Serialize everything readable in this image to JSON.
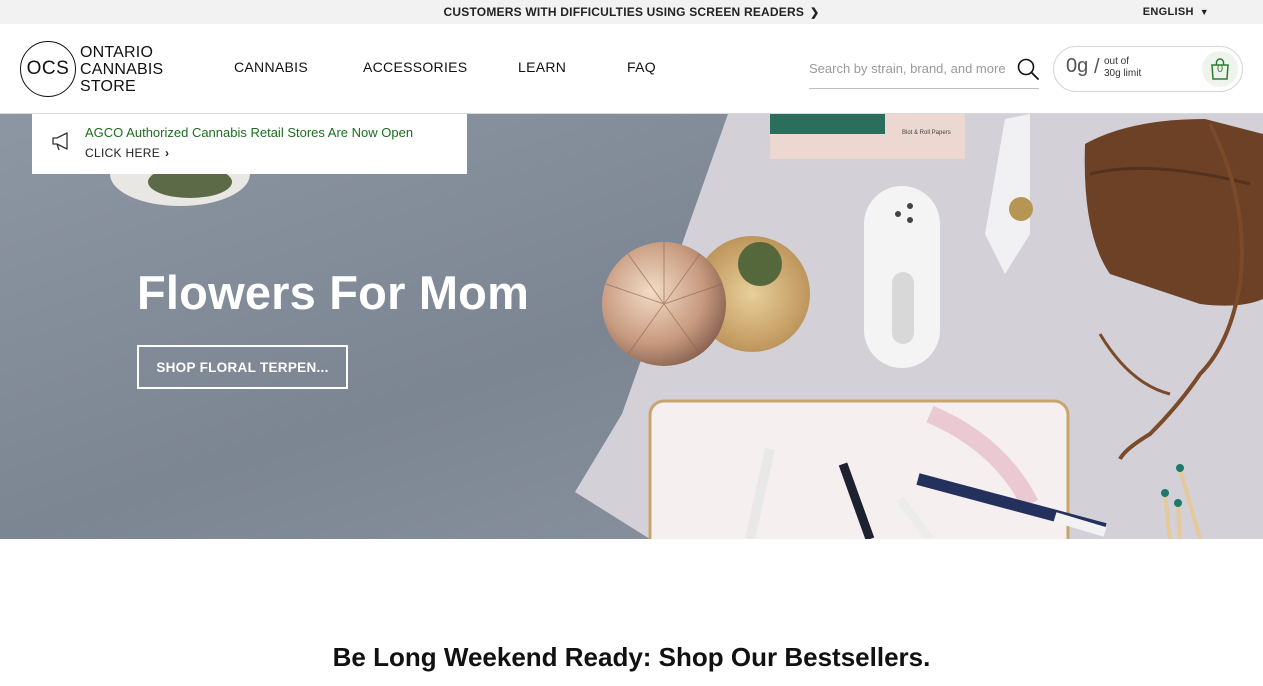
{
  "topbar": {
    "screen_reader_text": "CUSTOMERS WITH DIFFICULTIES USING SCREEN READERS",
    "language": "ENGLISH"
  },
  "logo": {
    "mark": "OCS",
    "line1": "ONTARIO",
    "line2": "CANNABIS",
    "line3": "STORE"
  },
  "nav": {
    "items": [
      {
        "label": "CANNABIS"
      },
      {
        "label": "ACCESSORIES"
      },
      {
        "label": "LEARN"
      },
      {
        "label": "FAQ"
      }
    ]
  },
  "search": {
    "placeholder": "Search by strain, brand, and more",
    "icon": "search-icon"
  },
  "limit": {
    "amount": "0g",
    "separator": "/",
    "out_of": "out of",
    "limit_text": "30g limit",
    "cart_count": "0",
    "cart_icon": "shopping-bag-icon",
    "accent": "#2e7d32"
  },
  "notice": {
    "icon": "megaphone-icon",
    "message": "AGCO Authorized Cannabis Retail Stores Are Now Open",
    "cta": "CLICK HERE",
    "color": "#1b6e1f"
  },
  "hero": {
    "title": "Flowers For Mom",
    "button": "SHOP FLORAL TERPEN...",
    "booklet_label": "Blot & Roll Papers"
  },
  "section": {
    "title": "Be Long Weekend Ready: Shop Our Bestsellers."
  }
}
